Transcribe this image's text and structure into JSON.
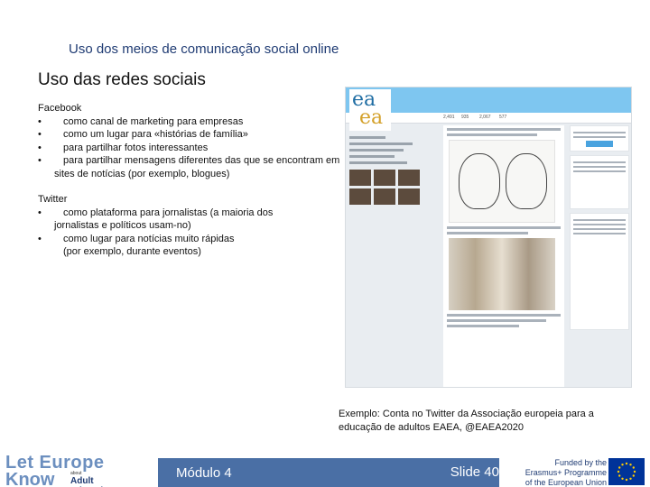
{
  "header": {
    "title": "Uso dos meios de comunicação social online"
  },
  "slide": {
    "title": "Uso das redes sociais"
  },
  "facebook": {
    "heading": "Facebook",
    "bullets": [
      "como canal de marketing para empresas",
      "como um lugar para «histórias de família»",
      "para partilhar fotos interessantes",
      "para partilhar mensagens diferentes das que se encontram em"
    ],
    "bullet_continuation": "sites de notícias (por exemplo, blogues)"
  },
  "twitter": {
    "heading": "Twitter",
    "bullet1": "como plataforma para jornalistas (a maioria dos",
    "bullet1_cont": "jornalistas e políticos usam-no)",
    "bullet2": "como lugar para notícias muito rápidas",
    "bullet2_cont": "(por exemplo, durante eventos)"
  },
  "bullet_char": "•",
  "screenshot": {
    "logo_line1": "ea",
    "logo_line2": "ea",
    "nav_items": [
      "2,491",
      "935",
      "2,067",
      "577"
    ]
  },
  "caption": {
    "line1": "Exemplo: Conta no Twitter da Associação europeia para a",
    "line2": "educação de adultos EAEA, @EAEA2020"
  },
  "footer": {
    "module": "Módulo 4",
    "slide_number": "Slide 40",
    "logo_line1": "Let Europe",
    "logo_line2": "Know",
    "logo_about": "about",
    "logo_tagline": "Adult Education",
    "funded_line1": "Funded by the",
    "funded_line2": "Erasmus+ Programme",
    "funded_line3": "of the European Union"
  },
  "colors": {
    "header_title": "#1f3b73",
    "footer_bar": "#4a6fa5",
    "eu_flag": "#003399",
    "eu_star": "#ffcc00"
  }
}
